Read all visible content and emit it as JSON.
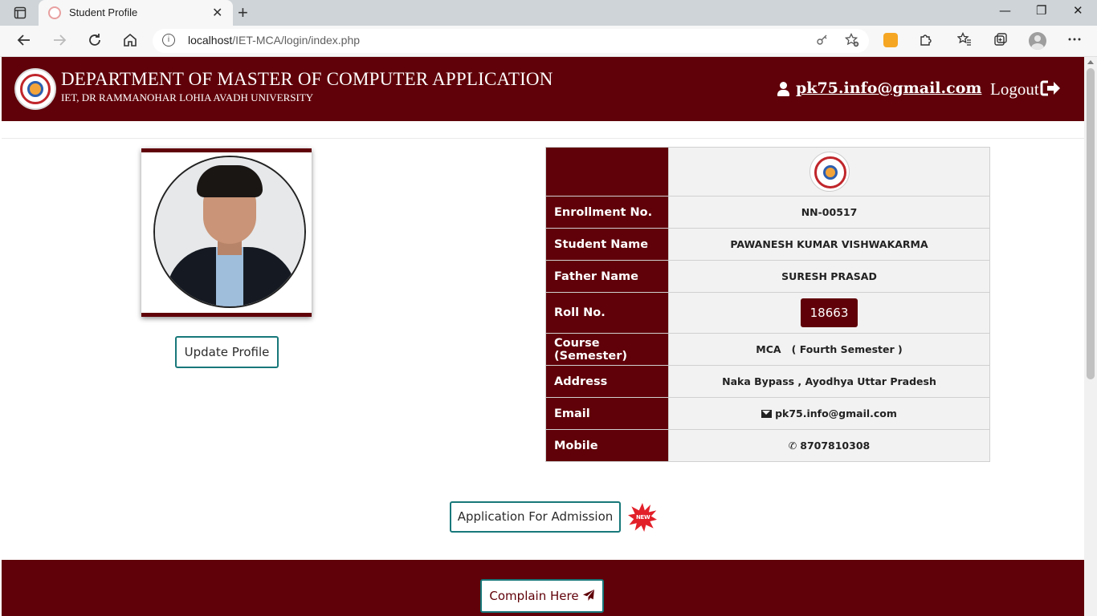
{
  "browser": {
    "tab_title": "Student Profile",
    "tab_close": "✕",
    "new_tab": "+",
    "window_minimize": "—",
    "window_maximize": "❐",
    "window_close": "✕",
    "url_host": "localhost",
    "url_path": "/IET-MCA/login/index.php",
    "icons": {
      "back": "back-arrow-icon",
      "forward": "forward-arrow-icon",
      "reload": "reload-icon",
      "home": "home-icon",
      "site_info": "info-icon",
      "key": "key-icon",
      "favorites_add": "star-plus-icon",
      "extension": "extension-icon",
      "puzzle": "puzzle-icon",
      "favorites": "favorites-icon",
      "collections": "collections-icon",
      "profile": "profile-avatar",
      "more": "more-icon"
    }
  },
  "header": {
    "title": "DEPARTMENT OF MASTER OF COMPUTER APPLICATION",
    "subtitle": "IET, DR RAMMANOHAR LOHIA AVADH UNIVERSITY",
    "user_email": "pk75.info@gmail.com",
    "logout_label": "Logout"
  },
  "profile": {
    "update_button": "Update Profile"
  },
  "student": {
    "enrollment_label": "Enrollment No.",
    "enrollment_value": "NN-00517",
    "name_label": "Student Name",
    "name_value": "PAWANESH KUMAR VISHWAKARMA",
    "father_label": "Father Name",
    "father_value": "SURESH PRASAD",
    "roll_label": "Roll No.",
    "roll_value": "18663",
    "course_label": "Course (Semester)",
    "course_value": "MCA   ( Fourth Semester )",
    "address_label": "Address",
    "address_value": "Naka Bypass , Ayodhya Uttar Pradesh",
    "email_label": "Email",
    "email_value": "pk75.info@gmail.com",
    "mobile_label": "Mobile",
    "mobile_value": "8707810308"
  },
  "actions": {
    "admission_button": "Application For Admission",
    "new_badge": "NEW",
    "complain_button": "Complain Here"
  },
  "colors": {
    "brand": "#600109",
    "button_border": "#18787a",
    "new_badge": "#e2202a"
  }
}
